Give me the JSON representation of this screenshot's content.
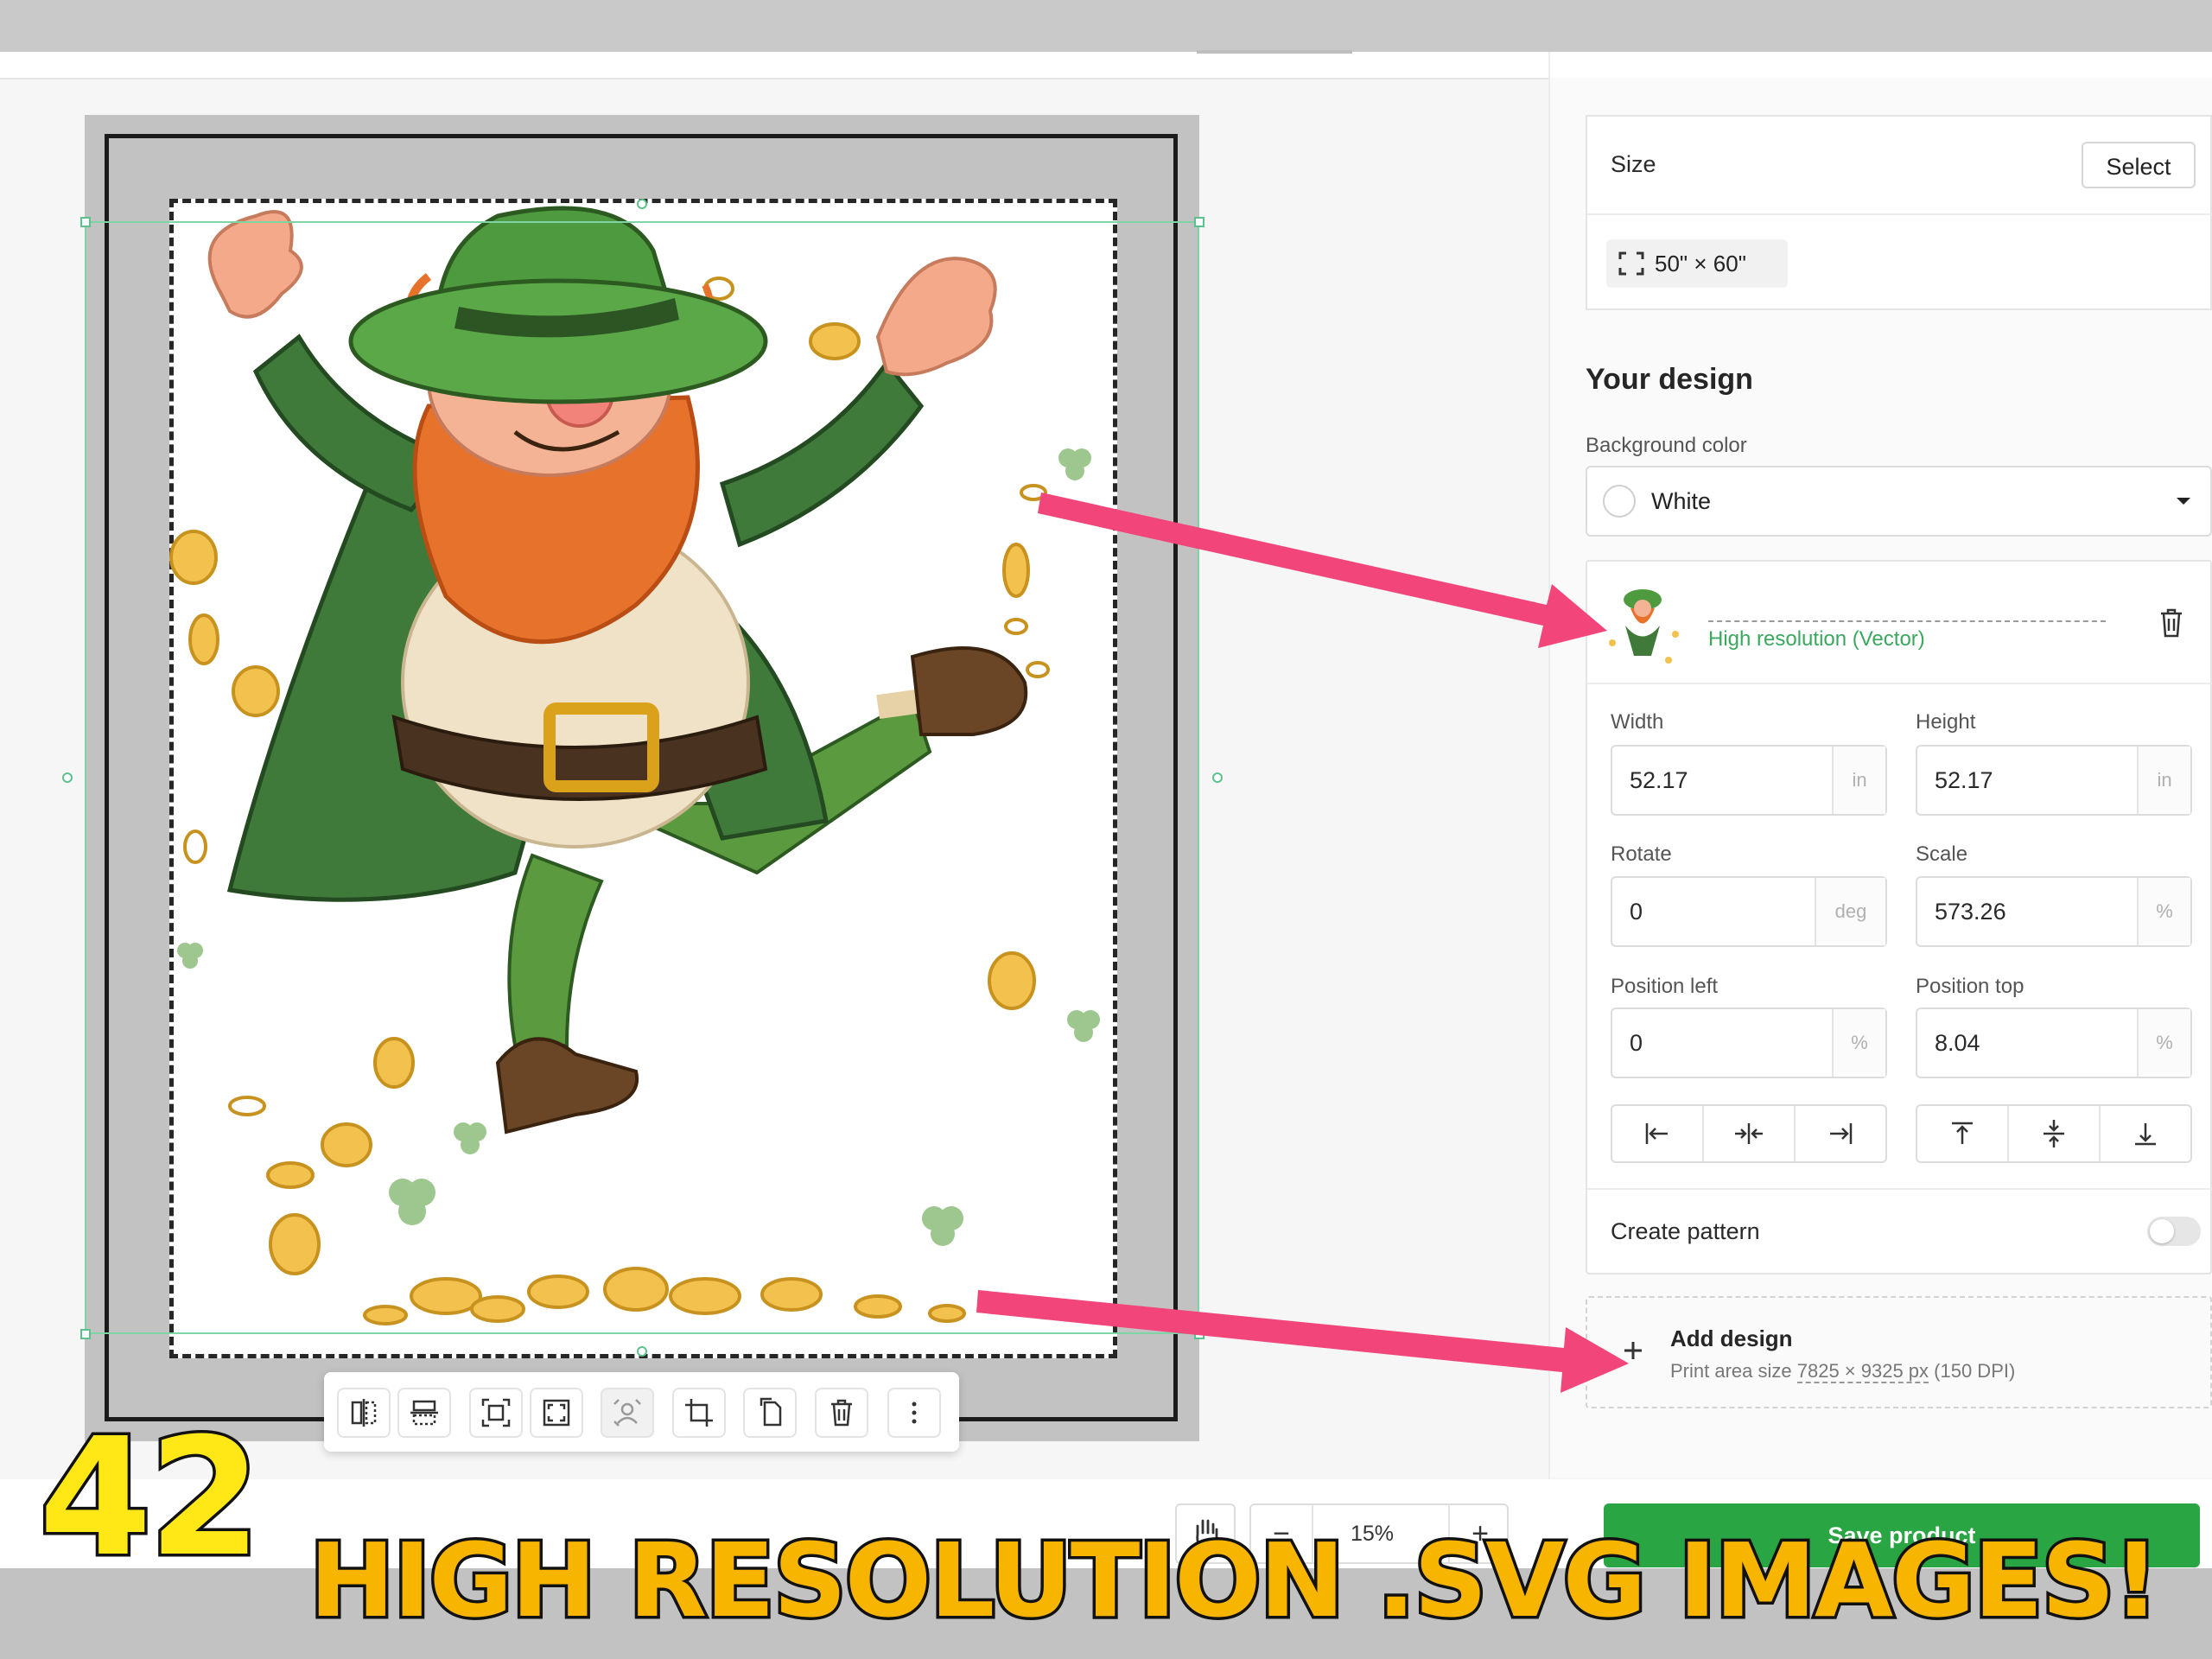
{
  "colors": {
    "accent_green": "#2aa544",
    "quality_green": "#3aa85d",
    "arrow_pink": "#f2457a",
    "headline_yellow": "#f7b500",
    "number_yellow": "#ffe816"
  },
  "toolbar": {
    "items": [
      {
        "icon": "flip-horizontal-icon"
      },
      {
        "icon": "flip-vertical-icon"
      },
      {
        "icon": "fit-to-print-area-icon"
      },
      {
        "icon": "fill-print-area-icon"
      },
      {
        "icon": "remove-background-icon",
        "disabled": true
      },
      {
        "icon": "crop-icon"
      },
      {
        "icon": "duplicate-icon"
      },
      {
        "icon": "delete-icon"
      },
      {
        "icon": "more-options-icon"
      }
    ]
  },
  "panel": {
    "size": {
      "label": "Size",
      "select_label": "Select",
      "value": "50\" × 60\""
    },
    "design": {
      "heading": "Your design",
      "background_color_label": "Background color",
      "background_color_value": "White",
      "layer": {
        "quality": "High resolution (Vector)"
      },
      "width_label": "Width",
      "width_value": "52.17",
      "width_unit": "in",
      "height_label": "Height",
      "height_value": "52.17",
      "height_unit": "in",
      "rotate_label": "Rotate",
      "rotate_value": "0",
      "rotate_unit": "deg",
      "scale_label": "Scale",
      "scale_value": "573.26",
      "scale_unit": "%",
      "pos_left_label": "Position left",
      "pos_left_value": "0",
      "pos_left_unit": "%",
      "pos_top_label": "Position top",
      "pos_top_value": "8.04",
      "pos_top_unit": "%",
      "pattern_label": "Create pattern",
      "pattern_enabled": false
    },
    "add_design": {
      "label": "Add design",
      "print_area_prefix": "Print area size ",
      "print_area_px": "7825 × 9325 px",
      "print_area_dpi": " (150 DPI)"
    }
  },
  "bottom": {
    "zoom_value": "15%",
    "save_label": "Save product"
  },
  "overlay": {
    "number": "42",
    "headline": "HIGH RESOLUTION .SVG IMAGES!"
  }
}
